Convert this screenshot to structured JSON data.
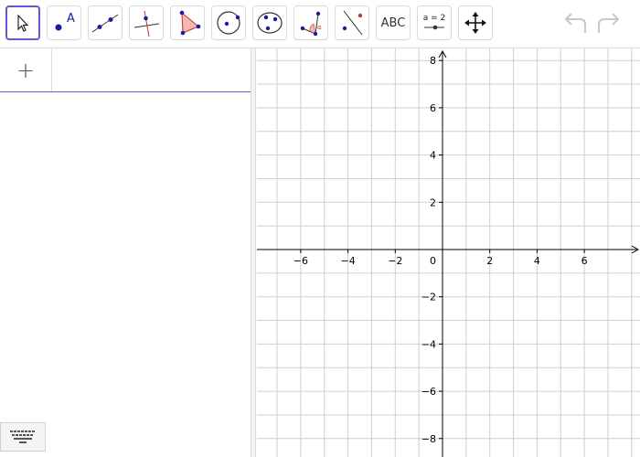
{
  "toolbar": {
    "tools": [
      {
        "name": "move-tool",
        "icon": "cursor-arrow-icon",
        "selected": true
      },
      {
        "name": "point-tool",
        "icon": "point-icon",
        "label": "A"
      },
      {
        "name": "line-tool",
        "icon": "line-icon"
      },
      {
        "name": "perpendicular-line-tool",
        "icon": "perpendicular-icon"
      },
      {
        "name": "polygon-tool",
        "icon": "polygon-icon"
      },
      {
        "name": "circle-center-point-tool",
        "icon": "circle-center-icon"
      },
      {
        "name": "circle-three-points-tool",
        "icon": "circle-three-points-icon"
      },
      {
        "name": "angle-tool",
        "icon": "angle-icon",
        "label": "α"
      },
      {
        "name": "reflect-tool",
        "icon": "reflect-icon"
      },
      {
        "name": "text-tool",
        "icon": "text-icon",
        "label": "ABC"
      },
      {
        "name": "slider-tool",
        "icon": "slider-icon",
        "label": "a = 2"
      },
      {
        "name": "move-graphics-view-tool",
        "icon": "move-arrows-icon"
      }
    ],
    "undo_icon": "undo-icon",
    "redo_icon": "redo-icon"
  },
  "algebra": {
    "add_button_label": "+",
    "input_value": ""
  },
  "keyboard_icon": "keyboard-icon",
  "graphics": {
    "x_range": [
      -8,
      8
    ],
    "y_range": [
      -8,
      8
    ],
    "x_tick_labels": [
      "−6",
      "−4",
      "−2",
      "2",
      "4",
      "6"
    ],
    "y_tick_labels": [
      "8",
      "6",
      "4",
      "2",
      "−2",
      "−4",
      "−6",
      "−8"
    ],
    "origin_label": "0",
    "grid": true
  },
  "colors": {
    "accent": "#6557d2",
    "point_blue": "#1a1aa6",
    "polygon_fill": "#f4b6b0",
    "line_red": "#c0392b",
    "grid": "#cfcfcf"
  }
}
